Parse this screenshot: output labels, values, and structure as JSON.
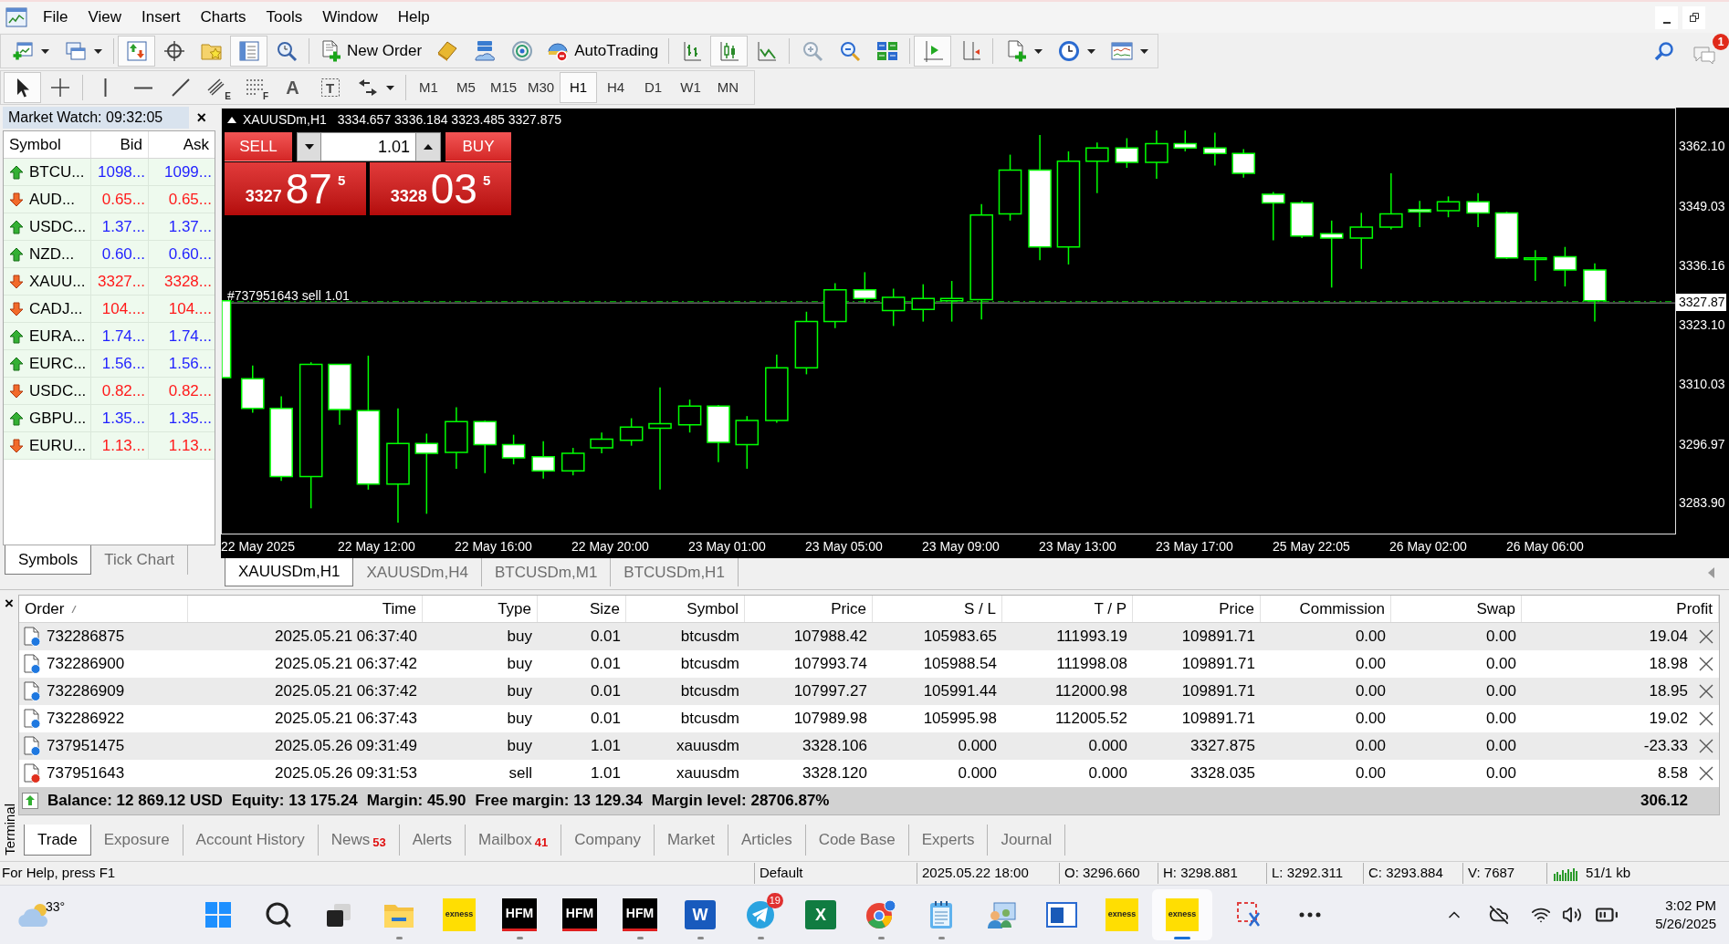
{
  "menu": [
    "File",
    "View",
    "Insert",
    "Charts",
    "Tools",
    "Window",
    "Help"
  ],
  "toolbar": [
    {
      "kind": "icon",
      "pressed": false,
      "caret": true
    },
    {
      "kind": "icon",
      "pressed": false,
      "caret": true
    },
    {
      "kind": "separator"
    },
    {
      "kind": "icon",
      "pressed": true
    },
    {
      "kind": "icon",
      "pressed": false
    },
    {
      "kind": "icon",
      "pressed": false
    },
    {
      "kind": "icon",
      "pressed": true
    },
    {
      "kind": "icon",
      "pressed": false
    },
    {
      "kind": "separator"
    },
    {
      "kind": "icon",
      "label": "New Order",
      "pressed": false
    },
    {
      "kind": "icon",
      "pressed": false
    },
    {
      "kind": "icon",
      "pressed": false
    },
    {
      "kind": "icon",
      "pressed": false
    },
    {
      "kind": "icon",
      "label": "AutoTrading",
      "pressed": false,
      "on": false
    },
    {
      "kind": "separator"
    },
    {
      "kind": "icon",
      "pressed": false
    },
    {
      "kind": "icon",
      "pressed": true
    },
    {
      "kind": "icon",
      "pressed": false
    },
    {
      "kind": "separator"
    },
    {
      "kind": "icon",
      "pressed": false
    },
    {
      "kind": "icon",
      "pressed": false
    },
    {
      "kind": "icon",
      "pressed": false
    },
    {
      "kind": "separator"
    },
    {
      "kind": "icon",
      "pressed": true
    },
    {
      "kind": "icon",
      "pressed": false
    },
    {
      "kind": "separator"
    },
    {
      "kind": "icon",
      "pressed": false,
      "caret": true
    },
    {
      "kind": "icon",
      "pressed": false,
      "caret": true
    },
    {
      "kind": "icon",
      "pressed": false,
      "caret": true
    }
  ],
  "chat_badge": "1",
  "drawing_tools": [
    {
      "kind": "icon",
      "pressed": true
    },
    {
      "kind": "icon",
      "pressed": false
    },
    {
      "kind": "separator"
    },
    {
      "kind": "icon",
      "pressed": false
    },
    {
      "kind": "icon",
      "pressed": false
    },
    {
      "kind": "icon",
      "pressed": false
    },
    {
      "kind": "icon",
      "glyph": "E",
      "pressed": false
    },
    {
      "kind": "icon",
      "glyph": "F",
      "pressed": false
    },
    {
      "kind": "glyph",
      "glyph": "A",
      "pressed": false
    },
    {
      "kind": "icon",
      "glyph": "T",
      "pressed": false
    },
    {
      "kind": "icon",
      "pressed": false,
      "caret": true
    }
  ],
  "timeframes": [
    {
      "label": "M1",
      "selected": false
    },
    {
      "label": "M5",
      "selected": false
    },
    {
      "label": "M15",
      "selected": false
    },
    {
      "label": "M30",
      "selected": false
    },
    {
      "label": "H1",
      "selected": true
    },
    {
      "label": "H4",
      "selected": false
    },
    {
      "label": "D1",
      "selected": false
    },
    {
      "label": "W1",
      "selected": false
    },
    {
      "label": "MN",
      "selected": false
    }
  ],
  "market_watch": {
    "title": "Market Watch: 09:32:05",
    "close": "×",
    "columns": [
      "Symbol",
      "Bid",
      "Ask"
    ],
    "rows": [
      {
        "symbol": "BTCU...",
        "bid": "1098...",
        "ask": "1099...",
        "rising": true
      },
      {
        "symbol": "AUD...",
        "bid": "0.65...",
        "ask": "0.65...",
        "rising": false
      },
      {
        "symbol": "USDC...",
        "bid": "1.37...",
        "ask": "1.37...",
        "rising": true
      },
      {
        "symbol": "NZD...",
        "bid": "0.60...",
        "ask": "0.60...",
        "rising": true
      },
      {
        "symbol": "XAUU...",
        "bid": "3327...",
        "ask": "3328...",
        "rising": false
      },
      {
        "symbol": "CADJ...",
        "bid": "104....",
        "ask": "104....",
        "rising": false
      },
      {
        "symbol": "EURA...",
        "bid": "1.74...",
        "ask": "1.74...",
        "rising": true
      },
      {
        "symbol": "EURC...",
        "bid": "1.56...",
        "ask": "1.56...",
        "rising": true
      },
      {
        "symbol": "USDC...",
        "bid": "0.82...",
        "ask": "0.82...",
        "rising": false
      },
      {
        "symbol": "GBPU...",
        "bid": "1.35...",
        "ask": "1.35...",
        "rising": true
      },
      {
        "symbol": "EURU...",
        "bid": "1.13...",
        "ask": "1.13...",
        "rising": false
      }
    ],
    "tabs": [
      {
        "label": "Symbols",
        "selected": true
      },
      {
        "label": "Tick Chart",
        "selected": false
      }
    ]
  },
  "chart": {
    "symbol": "XAUUSDm,H1",
    "ohlc": "3334.657 3336.184 3323.485 3327.875",
    "order_label": "#737951643 sell 1.01",
    "price_labels": [
      "3362.10",
      "3349.03",
      "3336.16",
      "3323.10",
      "3310.03",
      "3296.97",
      "3283.90"
    ],
    "current_price": "3327.87",
    "time_labels": [
      "22 May 2025",
      "22 May 12:00",
      "22 May 16:00",
      "22 May 20:00",
      "23 May 01:00",
      "23 May 05:00",
      "23 May 09:00",
      "23 May 13:00",
      "23 May 17:00",
      "25 May 22:05",
      "26 May 02:00",
      "26 May 06:00"
    ]
  },
  "one_click": {
    "sell": "SELL",
    "buy": "BUY",
    "lots": "1.01",
    "sell_price": {
      "prefix": "3327",
      "pips": "87",
      "point": "5"
    },
    "buy_price": {
      "prefix": "3328",
      "pips": "03",
      "point": "5"
    }
  },
  "chart_tabs": [
    {
      "label": "XAUUSDm,H1",
      "selected": true
    },
    {
      "label": "XAUUSDm,H4",
      "selected": false
    },
    {
      "label": "BTCUSDm,M1",
      "selected": false
    },
    {
      "label": "BTCUSDm,H1",
      "selected": false
    }
  ],
  "terminal": {
    "title": "Terminal",
    "close": "×",
    "columns": [
      "Order",
      "Time",
      "Type",
      "Size",
      "Symbol",
      "Price",
      "S / L",
      "T / P",
      "Price",
      "Commission",
      "Swap",
      "Profit"
    ],
    "rows": [
      {
        "kind": "buy",
        "cells": [
          "732286875",
          "2025.05.21 06:37:40",
          "buy",
          "0.01",
          "btcusdm",
          "107988.42",
          "105983.65",
          "111993.19",
          "109891.71",
          "0.00",
          "0.00",
          "19.04"
        ]
      },
      {
        "kind": "buy",
        "cells": [
          "732286900",
          "2025.05.21 06:37:42",
          "buy",
          "0.01",
          "btcusdm",
          "107993.74",
          "105988.54",
          "111998.08",
          "109891.71",
          "0.00",
          "0.00",
          "18.98"
        ]
      },
      {
        "kind": "buy",
        "cells": [
          "732286909",
          "2025.05.21 06:37:42",
          "buy",
          "0.01",
          "btcusdm",
          "107997.27",
          "105991.44",
          "112000.98",
          "109891.71",
          "0.00",
          "0.00",
          "18.95"
        ]
      },
      {
        "kind": "buy",
        "cells": [
          "732286922",
          "2025.05.21 06:37:43",
          "buy",
          "0.01",
          "btcusdm",
          "107989.98",
          "105995.98",
          "112005.52",
          "109891.71",
          "0.00",
          "0.00",
          "19.02"
        ]
      },
      {
        "kind": "buy",
        "cells": [
          "737951475",
          "2025.05.26 09:31:49",
          "buy",
          "1.01",
          "xauusdm",
          "3328.106",
          "0.000",
          "0.000",
          "3327.875",
          "0.00",
          "0.00",
          "-23.33"
        ]
      },
      {
        "kind": "sell",
        "cells": [
          "737951643",
          "2025.05.26 09:31:53",
          "sell",
          "1.01",
          "xauusdm",
          "3328.120",
          "0.000",
          "0.000",
          "3328.035",
          "0.00",
          "0.00",
          "8.58"
        ]
      }
    ],
    "summary": [
      "Balance: 12 869.12 USD",
      "Equity: 13 175.24",
      "Margin: 45.90",
      "Free margin: 13 129.34",
      "Margin level: 28706.87%"
    ],
    "total_profit": "306.12",
    "tabs": [
      {
        "label": "Trade",
        "selected": true
      },
      {
        "label": "Exposure",
        "selected": false
      },
      {
        "label": "Account History",
        "selected": false
      },
      {
        "label": "News",
        "badge": "53",
        "selected": false
      },
      {
        "label": "Alerts",
        "selected": false
      },
      {
        "label": "Mailbox",
        "badge": "41",
        "selected": false
      },
      {
        "label": "Company",
        "selected": false
      },
      {
        "label": "Market",
        "selected": false
      },
      {
        "label": "Articles",
        "selected": false
      },
      {
        "label": "Code Base",
        "selected": false
      },
      {
        "label": "Experts",
        "selected": false
      },
      {
        "label": "Journal",
        "selected": false
      }
    ]
  },
  "status_bar": {
    "help": "For Help, press F1",
    "profile": "Default",
    "bar_info": [
      "2025.05.22 18:00",
      "O: 3296.660",
      "H: 3298.881",
      "L: 3292.311",
      "C: 3293.884",
      "V: 7687"
    ],
    "traffic": "51/1 kb"
  },
  "taskbar": {
    "weather": "33°",
    "apps": [
      {
        "kind": "start",
        "running": false,
        "selected": false
      },
      {
        "kind": "search",
        "running": false,
        "selected": false
      },
      {
        "kind": "task_view",
        "running": false,
        "selected": false
      },
      {
        "kind": "folder",
        "running": true,
        "selected": false
      },
      {
        "kind": "exness",
        "label": "exness",
        "running": false,
        "selected": false
      },
      {
        "kind": "hfm",
        "label": "HFM",
        "running": true,
        "selected": false
      },
      {
        "kind": "hfm",
        "label": "HFM",
        "running": false,
        "selected": false
      },
      {
        "kind": "hfm",
        "label": "HFM",
        "running": true,
        "selected": false
      },
      {
        "kind": "word",
        "label": "W",
        "running": true,
        "selected": false
      },
      {
        "kind": "telegram",
        "badge": "19",
        "running": true,
        "selected": false
      },
      {
        "kind": "excel",
        "label": "X",
        "running": false,
        "selected": false
      },
      {
        "kind": "chrome",
        "running": true,
        "selected": false
      },
      {
        "kind": "notepad",
        "running": true,
        "selected": false
      },
      {
        "kind": "contacts",
        "running": false,
        "selected": false
      },
      {
        "kind": "window",
        "running": false,
        "selected": false
      },
      {
        "kind": "exness",
        "label": "exness",
        "running": false,
        "selected": false
      },
      {
        "kind": "exness",
        "label": "exness",
        "running": true,
        "selected": true
      },
      {
        "kind": "snipping",
        "running": false,
        "selected": false
      },
      {
        "kind": "more",
        "running": false,
        "selected": false
      }
    ],
    "time": "3:02 PM",
    "date": "5/26/2025"
  }
}
